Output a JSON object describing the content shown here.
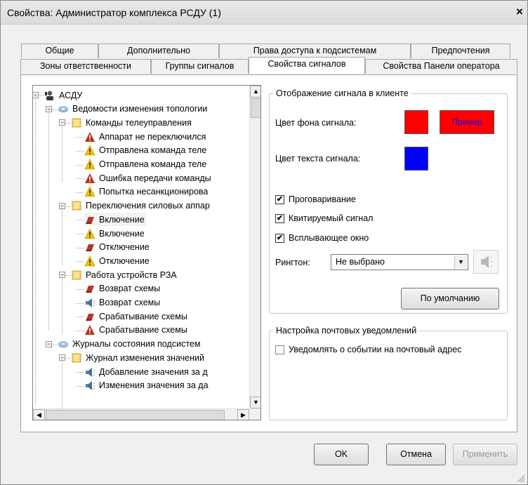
{
  "window": {
    "title": "Свойства: Администратор комплекса РСДУ (1)",
    "close_label": "×"
  },
  "tabs_row1": [
    "Общие",
    "Дополнительно",
    "Права доступа к подсистемам",
    "Предпочтения"
  ],
  "tabs_row2": [
    "Зоны ответственности",
    "Группы сигналов",
    "Свойства сигналов",
    "Свойства Панели оператора"
  ],
  "active_tab": "Свойства сигналов",
  "tree": {
    "items": [
      {
        "label": "АСДУ",
        "icon": "operator-icon"
      },
      {
        "label": "Ведомости изменения топологии",
        "icon": "disk-icon"
      },
      {
        "label": "Команды телеуправления",
        "icon": "folder-list-icon"
      },
      {
        "label": "Аппарат не переключился",
        "icon": "warning-red-icon"
      },
      {
        "label": "Отправлена команда теле",
        "icon": "warning-yellow-icon"
      },
      {
        "label": "Отправлена команда теле",
        "icon": "warning-yellow-icon"
      },
      {
        "label": "Ошибка передачи команды",
        "icon": "warning-red-icon"
      },
      {
        "label": "Попытка несанкционирова",
        "icon": "warning-yellow-icon"
      },
      {
        "label": "Переключения силовых аппар",
        "icon": "folder-list-icon"
      },
      {
        "label": "Включение",
        "icon": "eraser-icon"
      },
      {
        "label": "Включение",
        "icon": "warning-yellow-icon"
      },
      {
        "label": "Отключение",
        "icon": "eraser-icon"
      },
      {
        "label": "Отключение",
        "icon": "warning-yellow-icon"
      },
      {
        "label": "Работа устройств РЗА",
        "icon": "folder-list-icon"
      },
      {
        "label": "Возврат схемы",
        "icon": "eraser-icon"
      },
      {
        "label": "Возврат схемы",
        "icon": "speaker-icon"
      },
      {
        "label": "Срабатывание схемы",
        "icon": "eraser-icon"
      },
      {
        "label": "Срабатывание схемы",
        "icon": "warning-red-icon"
      },
      {
        "label": "Журналы состояния подсистем",
        "icon": "disk-icon"
      },
      {
        "label": "Журнал изменения значений",
        "icon": "folder-list-icon"
      },
      {
        "label": "Добавление значения за д",
        "icon": "speaker-icon"
      },
      {
        "label": "Изменения значения за да",
        "icon": "speaker-icon"
      }
    ]
  },
  "display_group": {
    "legend": "Отображение сигнала в клиенте",
    "bg_color_label": "Цвет фона сигнала:",
    "bg_color": "#ff0000",
    "sample_label": "Пример",
    "text_color_label": "Цвет текста сигнала:",
    "text_color": "#0000ff",
    "checkboxes": [
      {
        "label": "Проговаривание",
        "checked": true
      },
      {
        "label": "Квитируемый сигнал",
        "checked": true
      },
      {
        "label": "Всплывающее окно",
        "checked": true
      }
    ],
    "ringtone_label": "Рингтон:",
    "ringtone_value": "Не выбрано",
    "default_button": "По умолчанию"
  },
  "mail_group": {
    "legend": "Настройка почтовых уведомлений",
    "checkbox_label": "Уведомлять о событии на почтовый адрес",
    "checked": false
  },
  "buttons": {
    "ok": "OK",
    "cancel": "Отмена",
    "apply": "Применить"
  }
}
